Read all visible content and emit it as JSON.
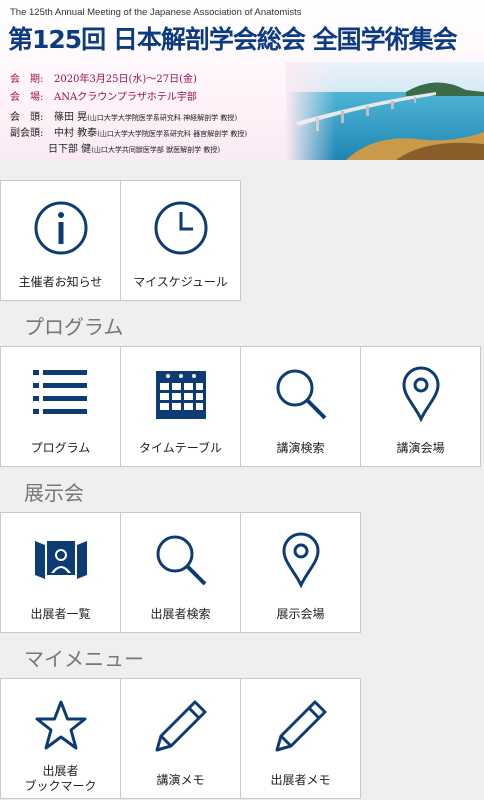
{
  "header": {
    "subtitle": "The 125th Annual Meeting of the Japanese Association of Anatomists",
    "title": "第125回 日本解剖学会総会 全国学術集会",
    "period_label": "会　期:",
    "period": "2020年3月25日(水)～27日(金)",
    "venue_label": "会　場:",
    "venue": "ANAクラウンプラザホテル宇部",
    "president_label": "会　頭:",
    "president": "篠田 晃",
    "president_aff": "(山口大学大学院医学系研究科 神経解剖学 教授)",
    "vice_label": "副会頭:",
    "vice1": "中村 教泰",
    "vice1_aff": "(山口大学大学院医学系研究科 器官解剖学 教授)",
    "vice2": "日下部 健",
    "vice2_aff": "(山口大学共同獣医学部 獣医解剖学 教授)"
  },
  "top_tiles": [
    {
      "label": "主催者お知らせ",
      "icon": "info-icon"
    },
    {
      "label": "マイスケジュール",
      "icon": "clock-icon"
    }
  ],
  "sections": {
    "program": "プログラム",
    "exhibition": "展示会",
    "mymenu": "マイメニュー"
  },
  "program_tiles": [
    {
      "label": "プログラム",
      "icon": "list-icon"
    },
    {
      "label": "タイムテーブル",
      "icon": "calendar-icon"
    },
    {
      "label": "講演検索",
      "icon": "search-icon"
    },
    {
      "label": "講演会場",
      "icon": "map-pin-icon"
    }
  ],
  "exhibit_tiles": [
    {
      "label": "出展者一覧",
      "icon": "exhibitor-booth-icon"
    },
    {
      "label": "出展者検索",
      "icon": "search-icon"
    },
    {
      "label": "展示会場",
      "icon": "map-pin-icon"
    }
  ],
  "mymenu_tiles": [
    {
      "label": "出展者\nブックマーク",
      "icon": "star-icon"
    },
    {
      "label": "講演メモ",
      "icon": "pencil-icon"
    },
    {
      "label": "出展者メモ",
      "icon": "pencil-icon"
    }
  ],
  "colors": {
    "icon": "#0d3b73",
    "title": "#0d3b82",
    "accent": "#a0104a"
  }
}
